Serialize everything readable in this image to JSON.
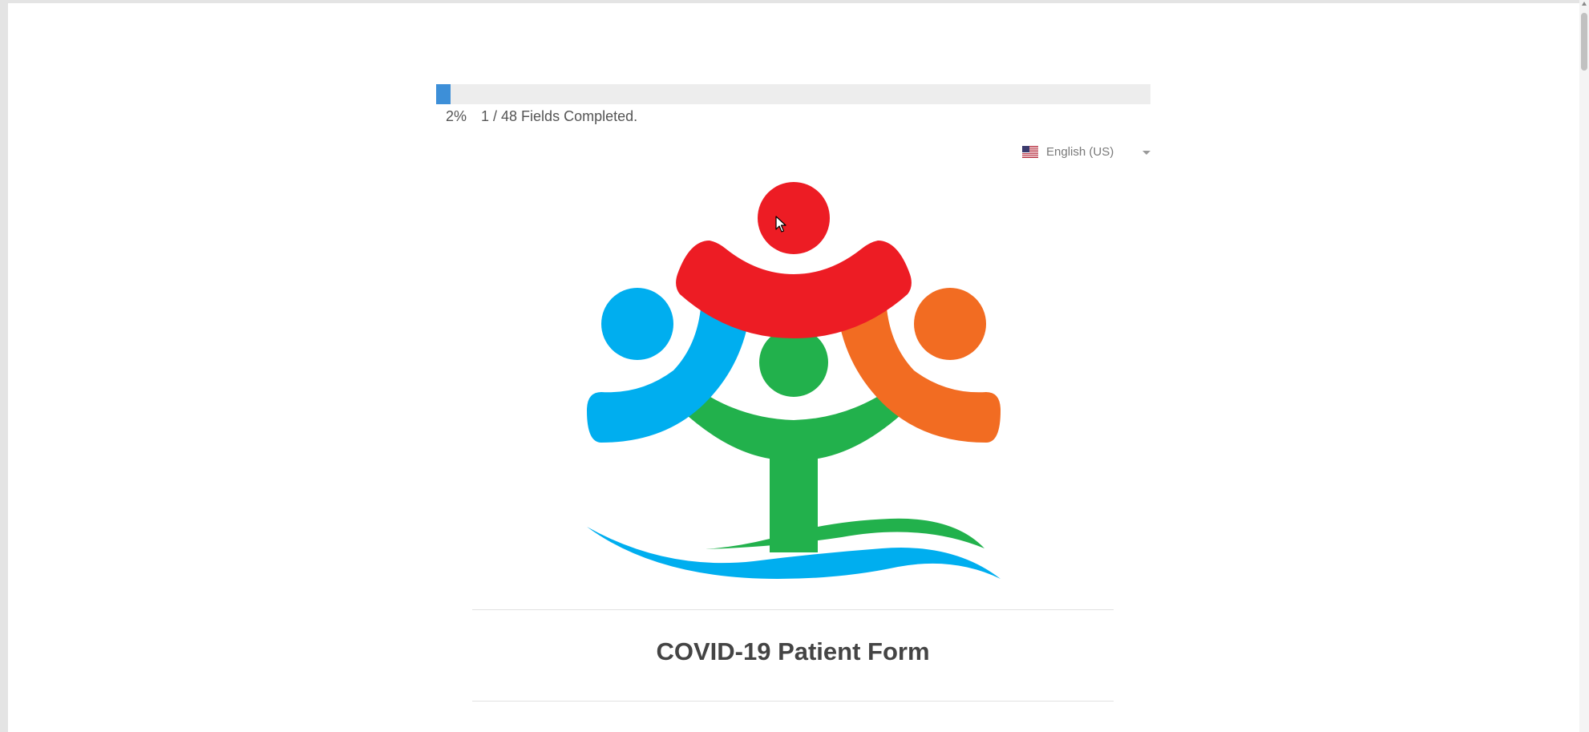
{
  "progress": {
    "percent_label": "2%",
    "fraction": 0.02,
    "fields_label": "1 / 48 Fields Completed."
  },
  "language": {
    "label": "English (US)",
    "flag_icon": "us-flag-icon"
  },
  "form": {
    "title": "COVID-19 Patient Form"
  },
  "logo": {
    "icon": "community-people-logo",
    "colors": {
      "red": "#ed1c24",
      "blue": "#00aeef",
      "orange": "#f26c22",
      "green": "#22b14c"
    }
  },
  "theme": {
    "progress_fill": "#3d8fd8",
    "progress_track": "#ededed"
  }
}
